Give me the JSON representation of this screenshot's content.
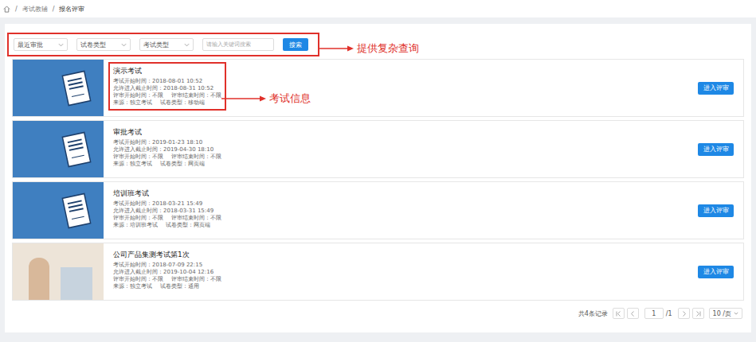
{
  "breadcrumb": {
    "separator": "/",
    "items": [
      "考试教辅",
      "报名评审"
    ]
  },
  "filters": {
    "dropdowns": [
      {
        "label": "最近审批"
      },
      {
        "label": "试卷类型"
      },
      {
        "label": "考试类型"
      }
    ],
    "search_placeholder": "请输入关键词搜索",
    "search_button": "搜索"
  },
  "annotations": {
    "filters": "提供复杂查询",
    "exam_info": "考试信息"
  },
  "exams": [
    {
      "title": "演示考试",
      "thumbnail": "exam-banner",
      "highlighted": true,
      "button": "进入评审",
      "lines": [
        [
          "考试开始时间：2018-08-01 10:52"
        ],
        [
          "允许进入截止时间：2018-08-31 10:52"
        ],
        [
          "评审开始时间：不限",
          "评审结束时间：不限"
        ],
        [
          "来源：独立考试",
          "试卷类型：移动端"
        ]
      ]
    },
    {
      "title": "审批考试",
      "thumbnail": "exam-banner",
      "highlighted": false,
      "button": "进入评审",
      "lines": [
        [
          "考试开始时间：2019-01-23 18:10"
        ],
        [
          "允许进入截止时间：2019-04-30 18:10"
        ],
        [
          "评审开始时间：不限",
          "评审结束时间：不限"
        ],
        [
          "来源：独立考试",
          "试卷类型：网页端"
        ]
      ]
    },
    {
      "title": "培训班考试",
      "thumbnail": "exam-banner",
      "highlighted": false,
      "button": "进入评审",
      "lines": [
        [
          "考试开始时间：2018-03-21 15:49"
        ],
        [
          "允许进入截止时间：2018-03-31 15:49"
        ],
        [
          "评审开始时间：不限",
          "评审结束时间：不限"
        ],
        [
          "来源：培训班考试",
          "试卷类型：网页端"
        ]
      ]
    },
    {
      "title": "公司产品集测考试第1次",
      "thumbnail": "photo",
      "highlighted": false,
      "button": "进入评审",
      "lines": [
        [
          "考试开始时间：2018-07-09 22:15"
        ],
        [
          "允许进入截止时间：2019-10-04 12:16"
        ],
        [
          "评审开始时间：不限",
          "评审结束时间：不限"
        ],
        [
          "来源：独立考试",
          "试卷类型：通用"
        ]
      ]
    }
  ],
  "pagination": {
    "total": "共4条记录",
    "page": "1",
    "pages": "/1",
    "page_size": "10 /页"
  }
}
